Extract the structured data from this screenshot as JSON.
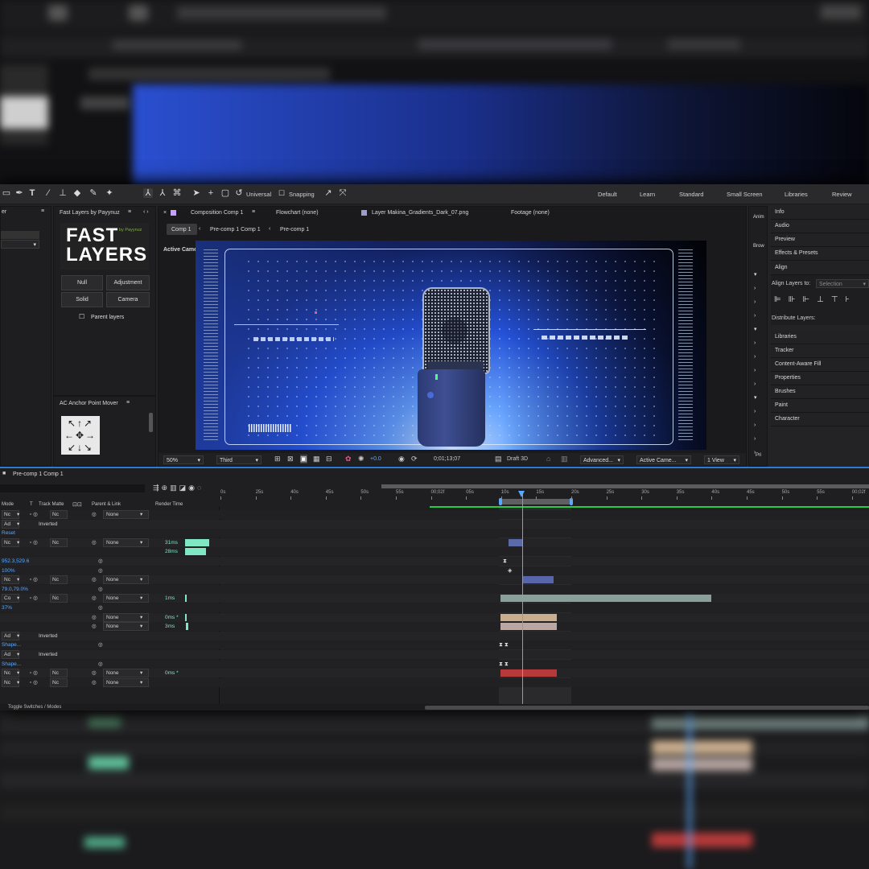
{
  "toolbar": {
    "universal_label": "Universal",
    "snapping_label": "Snapping",
    "workspaces": [
      "Default",
      "Learn",
      "Standard",
      "Small Screen",
      "Libraries",
      "Review"
    ]
  },
  "left_stub": {
    "title": "er"
  },
  "fast_layers": {
    "panel_title": "Fast Layers by Payynuz",
    "logo_line1": "FAST",
    "logo_line2": "LAYERS",
    "logo_by": "by Payynuz",
    "buttons": [
      "Null",
      "Adjustment",
      "Solid",
      "Camera"
    ],
    "parent_layers_label": "Parent layers"
  },
  "anchor_mover": {
    "panel_title": "AC Anchor Point Mover"
  },
  "composition": {
    "tabs": [
      "Composition Comp 1",
      "Flowchart (none)",
      "Layer Makina_Gradients_Dark_07.png",
      "Footage (none)"
    ],
    "breadcrumbs": [
      "Comp 1",
      "Pre-comp 1 Comp 1",
      "Pre-comp 1"
    ],
    "view_label": "Active Came",
    "footer": {
      "zoom": "50%",
      "resolution": "Third",
      "exposure": "+0.0",
      "timecode": "0;01;13;07",
      "renderer": "Draft 3D",
      "advanced": "Advanced...",
      "camera": "Active Came...",
      "views": "1 View"
    }
  },
  "right_panel": {
    "truncated_tabs": [
      "Anim",
      "Brow",
      "Pri"
    ],
    "items": [
      "Info",
      "Audio",
      "Preview",
      "Effects & Presets",
      "Align"
    ],
    "align_to_label": "Align Layers to:",
    "align_to_value": "Selection",
    "distribute_label": "Distribute Layers:",
    "items2": [
      "Libraries",
      "Tracker",
      "Content-Aware Fill",
      "Properties",
      "Brushes",
      "Paint",
      "Character"
    ]
  },
  "timeline": {
    "title": "Pre-comp 1 Comp 1",
    "headers": [
      "Mode",
      "T",
      "Track Matte",
      "Parent & Link",
      "Render Time"
    ],
    "ruler": [
      "0s",
      "25s",
      "40s",
      "45s",
      "50s",
      "55s",
      "00;02f",
      "05s",
      "10s",
      "15s",
      "20s",
      "25s",
      "30s",
      "35s",
      "40s",
      "45s",
      "50s",
      "55s",
      "00;02f"
    ],
    "rows": [
      {
        "c1": "Nc",
        "c2": "Nc",
        "parent": "None",
        "render": ""
      },
      {
        "c1": "Ad",
        "c2": "Inverted",
        "parent": "",
        "render": ""
      },
      {
        "c1": "Reset",
        "c2": "",
        "parent": "",
        "render": ""
      },
      {
        "c1": "Nc",
        "c2": "Nc",
        "parent": "None",
        "render": "31ms"
      },
      {
        "c1": "",
        "c2": "",
        "parent": "",
        "render": "28ms"
      },
      {
        "c1": "952.3,529.6",
        "c2": "",
        "parent": "",
        "render": ""
      },
      {
        "c1": "100%",
        "c2": "",
        "parent": "",
        "render": ""
      },
      {
        "c1": "Nc",
        "c2": "Nc",
        "parent": "None",
        "render": ""
      },
      {
        "c1": "79.0,79.0%",
        "c2": "",
        "parent": "",
        "render": ""
      },
      {
        "c1": "Co",
        "c2": "Nc",
        "parent": "None",
        "render": "1ms"
      },
      {
        "c1": "37%",
        "c2": "",
        "parent": "",
        "render": ""
      },
      {
        "c1": "",
        "c2": "",
        "parent": "None",
        "render": "0ms *"
      },
      {
        "c1": "",
        "c2": "",
        "parent": "None",
        "render": "3ms"
      },
      {
        "c1": "Ad",
        "c2": "Inverted",
        "parent": "",
        "render": ""
      },
      {
        "c1": "Shape...",
        "c2": "",
        "parent": "",
        "render": ""
      },
      {
        "c1": "Ad",
        "c2": "Inverted",
        "parent": "",
        "render": ""
      },
      {
        "c1": "Shape...",
        "c2": "",
        "parent": "",
        "render": ""
      },
      {
        "c1": "Nc",
        "c2": "Nc",
        "parent": "None",
        "render": "0ms *"
      },
      {
        "c1": "Nc",
        "c2": "Nc",
        "parent": "None",
        "render": ""
      }
    ],
    "footer_label": "Toggle Switches / Modes"
  },
  "colors": {
    "accent_blue": "#2d8ceb",
    "render_bar": "#7de8c2",
    "playhead": "#5aa9ff",
    "work_area_green": "#22cc44"
  }
}
